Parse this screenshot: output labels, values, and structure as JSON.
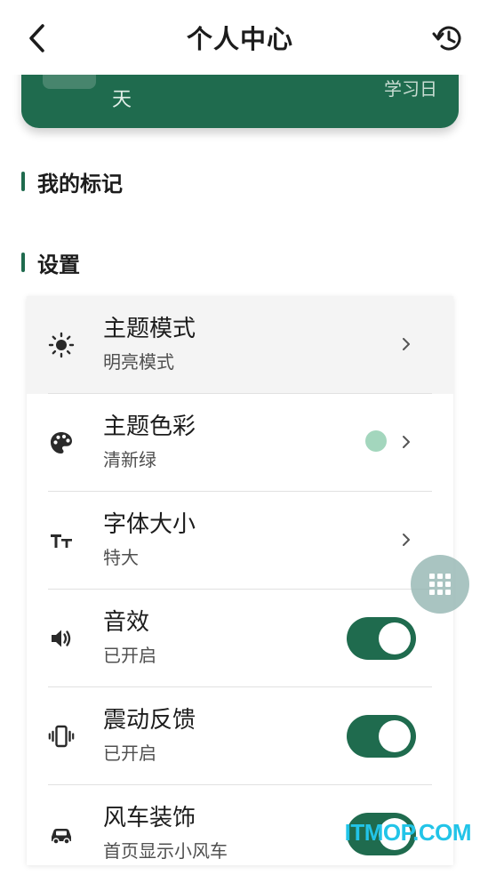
{
  "header": {
    "title": "个人中心"
  },
  "banner": {
    "day_text": "天",
    "study_label": "学习日"
  },
  "sections": {
    "marks_title": "我的标记",
    "settings_title": "设置"
  },
  "settings": {
    "theme_mode": {
      "label": "主题模式",
      "value": "明亮模式"
    },
    "theme_color": {
      "label": "主题色彩",
      "value": "清新绿",
      "swatch_color": "#a3d6bd"
    },
    "font_size": {
      "label": "字体大小",
      "value": "特大"
    },
    "sound": {
      "label": "音效",
      "value": "已开启",
      "on": true
    },
    "vibration": {
      "label": "震动反馈",
      "value": "已开启",
      "on": true
    },
    "windmill": {
      "label": "风车装饰",
      "value": "首页显示小风车",
      "on": true
    }
  },
  "watermark": "ITMOP.COM",
  "colors": {
    "accent": "#1f6b4e",
    "toggle_knob": "#ffffff",
    "highlight_row": "#f4f4f4"
  },
  "icons": [
    "back-arrow-icon",
    "history-icon",
    "brightness-icon",
    "palette-icon",
    "text-size-icon",
    "volume-icon",
    "vibration-icon",
    "car-icon",
    "chevron-right-icon",
    "grid-icon"
  ]
}
